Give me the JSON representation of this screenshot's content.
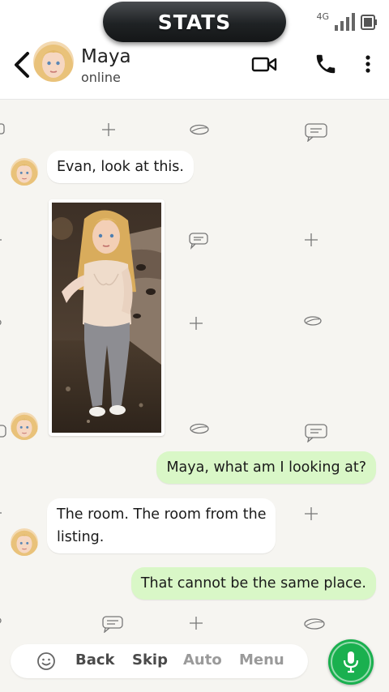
{
  "header": {
    "stats_label": "STATS",
    "network": "4G",
    "contact_name": "Maya",
    "contact_status": "online",
    "icons": [
      "back-arrow-icon",
      "video-call-icon",
      "phone-icon",
      "more-vert-icon",
      "signal-icon",
      "battery-icon"
    ]
  },
  "messages": [
    {
      "from": "Maya",
      "text": "Evan, look at this."
    },
    {
      "from": "Maya",
      "type": "image",
      "image": "selfie photo of a blonde woman in a dim, cluttered bedroom"
    },
    {
      "from": "me",
      "text": "Maya, what am I looking at?"
    },
    {
      "from": "Maya",
      "text_line1": "The room. The room from the",
      "text_line2": "listing."
    },
    {
      "from": "me",
      "text": "That cannot be the same place."
    }
  ],
  "controls": {
    "back": "Back",
    "skip": "Skip",
    "auto": "Auto",
    "menu": "Menu",
    "emoji_icon": "smiley-icon",
    "mic_icon": "mic-icon"
  },
  "colors": {
    "incoming_bubble": "#ffffff",
    "outgoing_bubble": "#d9f7c7",
    "mic_button": "#1ab04f",
    "chat_background": "#f6f5f1",
    "control_active": "#4a4a4a",
    "control_dim": "#9a9a9a"
  }
}
